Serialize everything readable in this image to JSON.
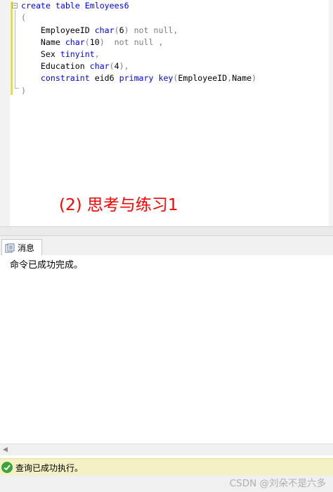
{
  "editor": {
    "lines": [
      [
        {
          "t": "create table ",
          "c": "kw"
        },
        {
          "t": "Emloyees6",
          "c": "kw"
        }
      ],
      [
        {
          "t": "(",
          "c": "gray"
        }
      ],
      [
        {
          "t": "    EmployeeID ",
          "c": ""
        },
        {
          "t": "char",
          "c": "kw"
        },
        {
          "t": "(",
          "c": "gray"
        },
        {
          "t": "6",
          "c": ""
        },
        {
          "t": ") ",
          "c": "gray"
        },
        {
          "t": "not null",
          "c": "gray"
        },
        {
          "t": ",",
          "c": "gray"
        }
      ],
      [
        {
          "t": "    Name ",
          "c": ""
        },
        {
          "t": "char",
          "c": "kw"
        },
        {
          "t": "(",
          "c": "gray"
        },
        {
          "t": "10",
          "c": ""
        },
        {
          "t": ")  ",
          "c": "gray"
        },
        {
          "t": "not null",
          "c": "gray"
        },
        {
          "t": " ,",
          "c": "gray"
        }
      ],
      [
        {
          "t": "    Sex ",
          "c": ""
        },
        {
          "t": "tinyint",
          "c": "kw"
        },
        {
          "t": ",",
          "c": "gray"
        }
      ],
      [
        {
          "t": "    Education ",
          "c": ""
        },
        {
          "t": "char",
          "c": "kw"
        },
        {
          "t": "(",
          "c": "gray"
        },
        {
          "t": "4",
          "c": ""
        },
        {
          "t": "),",
          "c": "gray"
        }
      ],
      [
        {
          "t": "    ",
          "c": ""
        },
        {
          "t": "constraint",
          "c": "kw"
        },
        {
          "t": " eid6 ",
          "c": ""
        },
        {
          "t": "primary key",
          "c": "kw"
        },
        {
          "t": "(",
          "c": "gray"
        },
        {
          "t": "EmployeeID",
          "c": ""
        },
        {
          "t": ",",
          "c": "gray"
        },
        {
          "t": "Name",
          "c": ""
        },
        {
          "t": ")",
          "c": "gray"
        }
      ],
      [
        {
          "t": ")",
          "c": "gray"
        }
      ]
    ],
    "annotation": "(2) 思考与练习1"
  },
  "tabs": {
    "messages_label": "消息"
  },
  "messages": {
    "text": "命令已成功完成。"
  },
  "status": {
    "text": "查询已成功执行。",
    "accent": "#f4f1c4",
    "ok_color": "#3aa33a"
  },
  "watermark": "CSDN @刘朵不是六多"
}
